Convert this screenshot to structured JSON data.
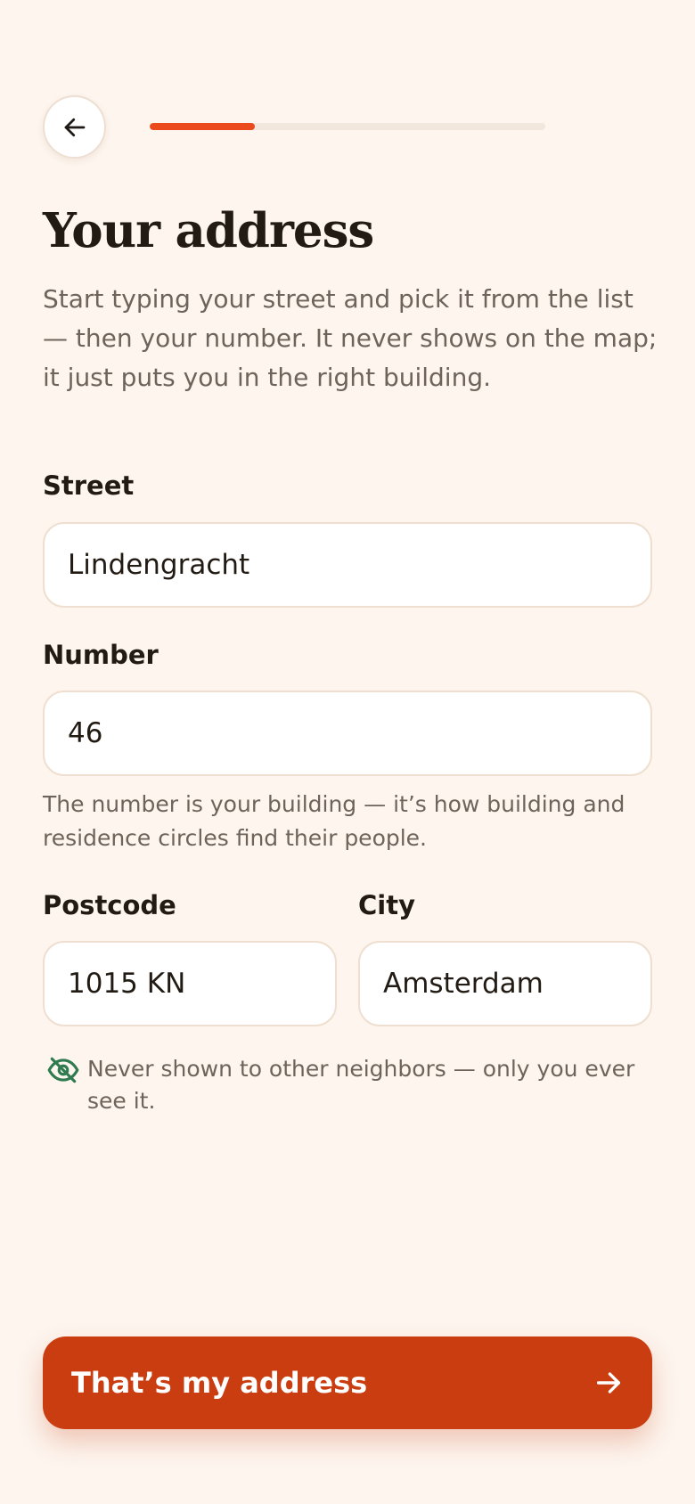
{
  "header": {
    "back_icon": "arrow-left-icon",
    "progress_fraction": 0.265
  },
  "title": "Your address",
  "subtitle": "Start typing your street and pick it from the list — then your number. It never shows on the map; it just puts you in the right building.",
  "fields": {
    "street": {
      "label": "Street",
      "value": "Lindengracht"
    },
    "number": {
      "label": "Number",
      "value": "46"
    },
    "number_helper": "The number is your building — it’s how building and residence circles find their people.",
    "postcode": {
      "label": "Postcode",
      "value": "1015 KN"
    },
    "city": {
      "label": "City",
      "value": "Amsterdam"
    }
  },
  "privacy": {
    "icon": "eye-off-icon",
    "icon_color": "#2f7a4f",
    "text": "Never shown to other neighbors — only you ever see it."
  },
  "cta": {
    "label": "That’s my address",
    "icon": "arrow-right-icon",
    "color": "#c93d10"
  },
  "colors": {
    "background": "#fdf5ee",
    "accent": "#ea4a1c"
  }
}
